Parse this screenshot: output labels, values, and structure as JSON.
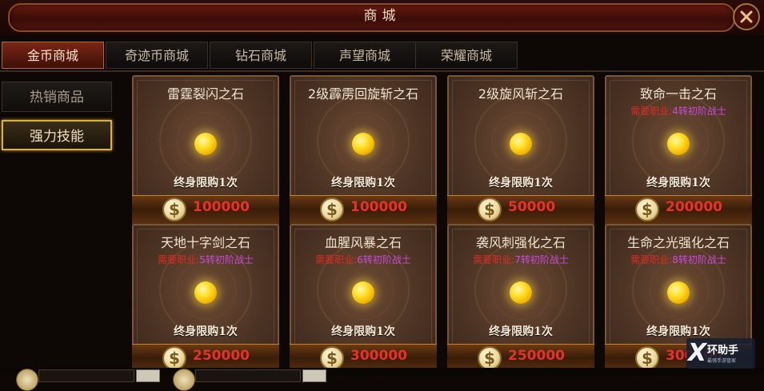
{
  "window": {
    "title": "商城"
  },
  "tabs": [
    {
      "label": "金币商城",
      "active": true
    },
    {
      "label": "奇迹币商城",
      "active": false
    },
    {
      "label": "钻石商城",
      "active": false
    },
    {
      "label": "声望商城",
      "active": false
    },
    {
      "label": "荣耀商城",
      "active": false
    }
  ],
  "sidebar": {
    "items": [
      {
        "label": "热销商品",
        "active": false
      },
      {
        "label": "强力技能",
        "active": true
      }
    ]
  },
  "items": [
    {
      "name": "雷霆裂闪之石",
      "req_label": "",
      "req_job": "",
      "limit": "终身限购1次",
      "price": "100000"
    },
    {
      "name": "2级霹雳回旋斩之石",
      "req_label": "",
      "req_job": "",
      "limit": "终身限购1次",
      "price": "100000"
    },
    {
      "name": "2级旋风斩之石",
      "req_label": "",
      "req_job": "",
      "limit": "终身限购1次",
      "price": "50000"
    },
    {
      "name": "致命一击之石",
      "req_label": "需要职业:",
      "req_job": "4转初阶战士",
      "limit": "终身限购1次",
      "price": "200000"
    },
    {
      "name": "天地十字剑之石",
      "req_label": "需要职业:",
      "req_job": "5转初阶战士",
      "limit": "终身限购1次",
      "price": "250000"
    },
    {
      "name": "血腥风暴之石",
      "req_label": "需要职业:",
      "req_job": "6转初阶战士",
      "limit": "终身限购1次",
      "price": "300000"
    },
    {
      "name": "袭风刺强化之石",
      "req_label": "需要职业:",
      "req_job": "7转初阶战士",
      "limit": "终身限购1次",
      "price": "250000"
    },
    {
      "name": "生命之光强化之石",
      "req_label": "需要职业:",
      "req_job": "8转初阶战士",
      "limit": "终身限购1次",
      "price": "300000"
    }
  ],
  "currency": {
    "symbol": "$"
  },
  "watermark": {
    "text": "环助手",
    "subtext": "最强手游管家",
    "mark": "X"
  },
  "colors": {
    "price": "#e9302a",
    "required_label": "#e02a25",
    "required_job": "#c84ad8",
    "active_tab": "#7a2618",
    "active_side_border": "#d9b044"
  }
}
